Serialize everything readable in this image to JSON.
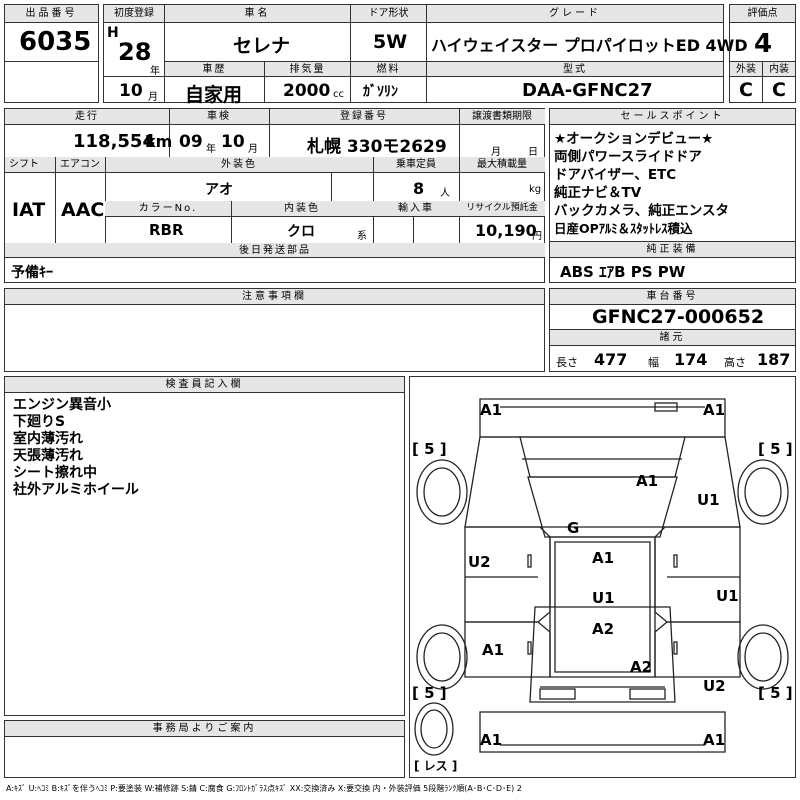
{
  "header": {
    "lot_label": "出品番号",
    "lot_no": "6035",
    "reg_label": "初度登録",
    "era": "H",
    "reg_year": "28",
    "year_unit": "年",
    "reg_month": "10",
    "month_unit": "月",
    "name_label": "車名",
    "car_name": "セレナ",
    "door_label": "ドア形状",
    "door": "5W",
    "grade_label": "グレード",
    "grade": "ハイウェイスター プロパイロットED 4WD",
    "score_label": "評価点",
    "score": "4",
    "history_label": "車歴",
    "history": "自家用",
    "disp_label": "排気量",
    "disp": "2000",
    "disp_unit": "cc",
    "fuel_label": "燃料",
    "fuel": "ｶﾞｿﾘﾝ",
    "model_label": "型式",
    "model": "DAA-GFNC27",
    "ext_label": "外装",
    "ext": "C",
    "int_label": "内装",
    "int": "C"
  },
  "row2": {
    "mileage_label": "走行",
    "mileage": "118,554",
    "mileage_unit": "km",
    "inspection_label": "車検",
    "insp_year": "09",
    "insp_year_unit": "年",
    "insp_month": "10",
    "insp_month_unit": "月",
    "plate_label": "登録番号",
    "plate": "札幌 330モ2629",
    "transfer_label": "譲渡書類期限",
    "transfer_month_unit": "月",
    "transfer_day_unit": "日",
    "shift_label": "シフト",
    "shift": "IAT",
    "ac_label": "エアコン",
    "ac": "AAC",
    "color_label": "外装色",
    "color": "アオ",
    "capacity_label": "乗車定員",
    "capacity": "8",
    "capacity_unit": "人",
    "load_label": "最大積載量",
    "load_unit": "kg",
    "color_no_label": "カラーNo.",
    "color_no": "RBR",
    "interior_label": "内装色",
    "interior": "クロ",
    "interior_unit": "系",
    "import_label": "輸入車",
    "recycle_label": "リサイクル預託金",
    "recycle": "10,190",
    "recycle_unit": "円"
  },
  "later_parts": {
    "label": "後日発送部品",
    "value": "予備ｷｰ"
  },
  "sales_points": {
    "label": "セールスポイント",
    "items": [
      "★オークションデビュー★",
      "両側パワースライドドア",
      "ドアバイザー、ETC",
      "純正ナビ＆TV",
      "バックカメラ、純正エンスタ",
      "日産OPｱﾙﾐ＆ｽﾀｯﾄﾚｽ積込"
    ]
  },
  "equipment": {
    "label": "純正装備",
    "value": "ABS ｴｱB PS PW"
  },
  "caution": {
    "label": "注意事項欄"
  },
  "chassis": {
    "label": "車台番号",
    "value": "GFNC27-000652"
  },
  "dims": {
    "label": "諸元",
    "length_label": "長さ",
    "length": "477",
    "width_label": "幅",
    "width": "174",
    "height_label": "高さ",
    "height": "187"
  },
  "inspector": {
    "label": "検査員記入欄",
    "notes": [
      "エンジン異音小",
      "下廻りS",
      "室内薄汚れ",
      "天張薄汚れ",
      "シート擦れ中",
      "社外アルミホイール"
    ]
  },
  "office": {
    "label": "事務局よりご案内"
  },
  "diagram": {
    "marks": {
      "a1_fl": "A1",
      "a1_fr": "A1",
      "a1_hood": "A1",
      "u1_fender_r": "U1",
      "g_glass": "G",
      "u2_door_l": "U2",
      "a1_roof": "A1",
      "u1_roof": "U1",
      "u1_door_r": "U1",
      "a2_roof": "A2",
      "a1_qtr_l": "A1",
      "a2_rear": "A2",
      "u2_qtr_r": "U2",
      "a1_rl": "A1",
      "a1_rr": "A1",
      "tire_fl": "[ 5 ]",
      "tire_fr": "[ 5 ]",
      "tire_rl": "[ 5 ]",
      "tire_rr": "[ 5 ]",
      "spare": "[ レス ]"
    }
  },
  "legend": "A:ｷｽﾞ U:ﾍｺﾐ B:ｷｽﾞを伴うﾍｺﾐ P:要塗装 W:補修跡 S:錆 C:腐食 G:ﾌﾛﾝﾄｶﾞﾗｽ点ｷｽﾞ XX:交換済み X:要交換 内・外装評価 5段階ﾗﾝｸ順(A･B･C･D･E) 2"
}
